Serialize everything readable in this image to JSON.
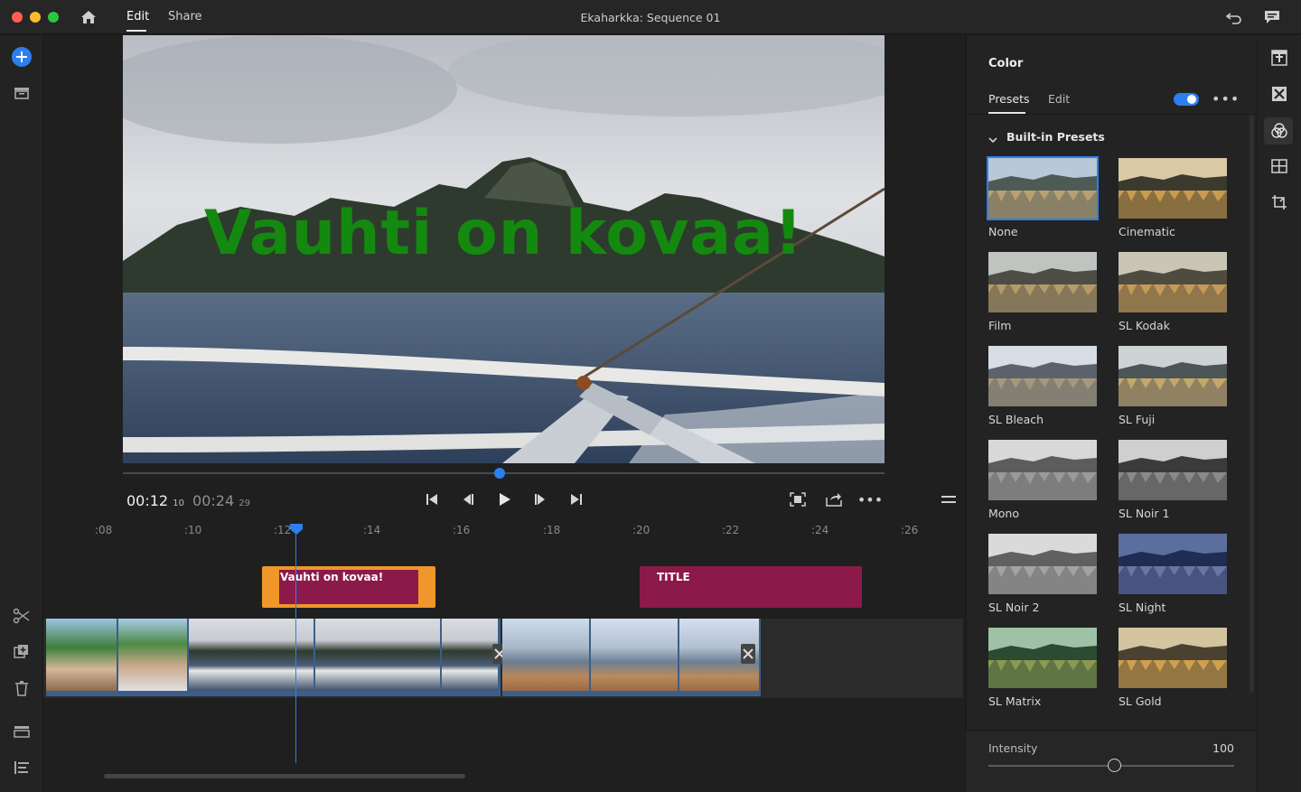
{
  "window": {
    "title": "Ekaharkka: Sequence 01",
    "tabs": [
      {
        "label": "Edit",
        "active": true
      },
      {
        "label": "Share",
        "active": false
      }
    ]
  },
  "preview": {
    "overlay_text": "Vauhti on kovaa!",
    "current_time": "00:12",
    "current_frame": "10",
    "duration_time": "00:24",
    "duration_frame": "29",
    "scrub_progress": 0.49
  },
  "timeline": {
    "ruler": [
      ":08",
      ":10",
      ":12",
      ":14",
      ":16",
      ":18",
      ":20",
      ":22",
      ":24",
      ":26"
    ],
    "title_clips": [
      {
        "label": "Vauhti on kovaa!"
      },
      {
        "label": "TITLE"
      }
    ]
  },
  "color_panel": {
    "title": "Color",
    "tabs": [
      {
        "label": "Presets",
        "active": true
      },
      {
        "label": "Edit",
        "active": false
      }
    ],
    "enabled": true,
    "section": "Built-in Presets",
    "presets": [
      {
        "name": "None",
        "style": "none",
        "selected": true
      },
      {
        "name": "Cinematic",
        "style": "cinematic"
      },
      {
        "name": "Film",
        "style": "film"
      },
      {
        "name": "SL Kodak",
        "style": "kodak"
      },
      {
        "name": "SL Bleach",
        "style": "bleach"
      },
      {
        "name": "SL Fuji",
        "style": "fuji"
      },
      {
        "name": "Mono",
        "style": "mono"
      },
      {
        "name": "SL Noir 1",
        "style": "noir1"
      },
      {
        "name": "SL Noir 2",
        "style": "noir2"
      },
      {
        "name": "SL Night",
        "style": "night"
      },
      {
        "name": "SL Matrix",
        "style": "matrix"
      },
      {
        "name": "SL Gold",
        "style": "gold"
      }
    ],
    "intensity_label": "Intensity",
    "intensity_value": "100"
  },
  "colors": {
    "accent": "#2d7ff0",
    "title_clip": "#8b1a4a",
    "title_clip_selected": "#f0962a",
    "overlay_text": "#14890f"
  }
}
